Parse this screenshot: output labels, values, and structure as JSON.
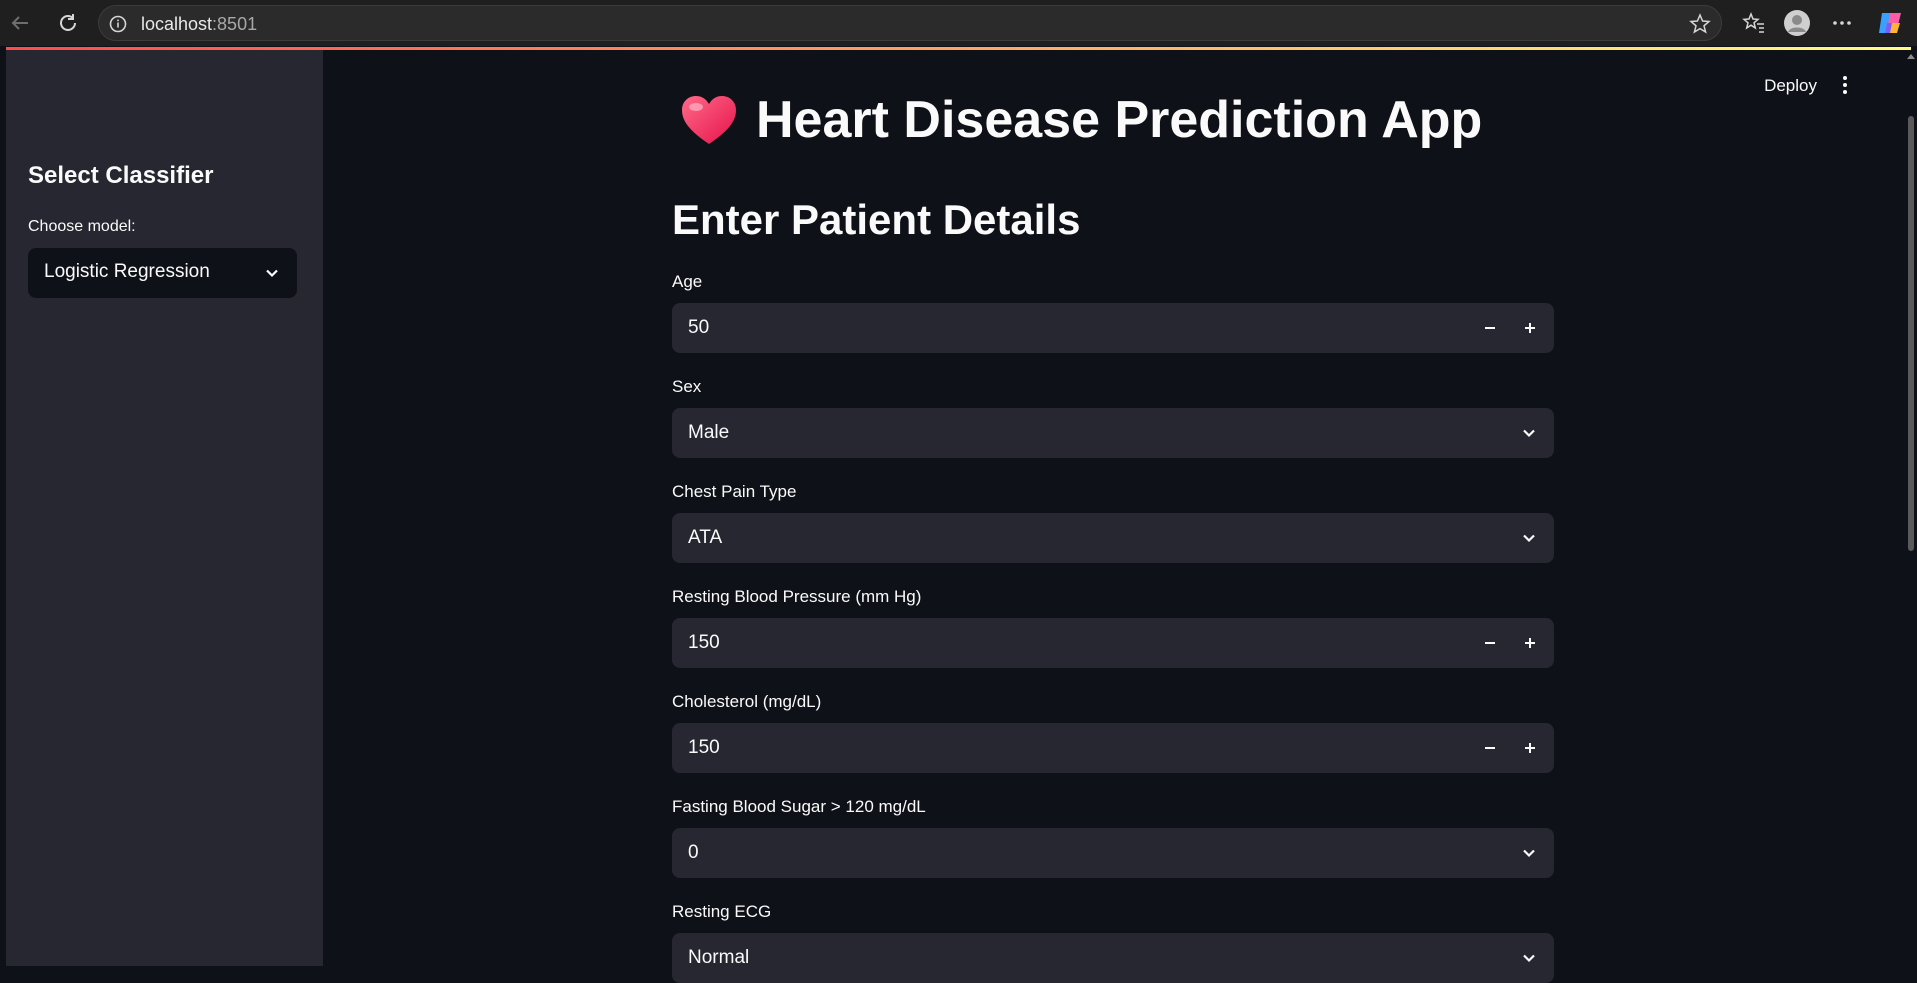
{
  "browser": {
    "url_host": "localhost",
    "url_port": ":8501"
  },
  "header": {
    "deploy_label": "Deploy"
  },
  "sidebar": {
    "title": "Select Classifier",
    "model_label": "Choose model:",
    "model_value": "Logistic Regression"
  },
  "main": {
    "title": "Heart Disease Prediction App",
    "section_title": "Enter Patient Details",
    "fields": {
      "age": {
        "label": "Age",
        "value": "50"
      },
      "sex": {
        "label": "Sex",
        "value": "Male"
      },
      "chest_pain": {
        "label": "Chest Pain Type",
        "value": "ATA"
      },
      "resting_bp": {
        "label": "Resting Blood Pressure (mm Hg)",
        "value": "150"
      },
      "cholesterol": {
        "label": "Cholesterol (mg/dL)",
        "value": "150"
      },
      "fasting_bs": {
        "label": "Fasting Blood Sugar > 120 mg/dL",
        "value": "0"
      },
      "resting_ecg": {
        "label": "Resting ECG",
        "value": "Normal"
      }
    }
  },
  "colors": {
    "background": "#0e1117",
    "sidebar": "#262730",
    "input": "#262730",
    "accent_start": "#ff4b4b",
    "accent_end": "#fffd80"
  },
  "icons": [
    "back-arrow-icon",
    "reload-icon",
    "info-icon",
    "star-icon",
    "favorites-icon",
    "profile-icon",
    "more-icon",
    "copilot-icon",
    "heart-icon",
    "chevron-down-icon",
    "minus-icon",
    "plus-icon",
    "kebab-menu-icon"
  ]
}
